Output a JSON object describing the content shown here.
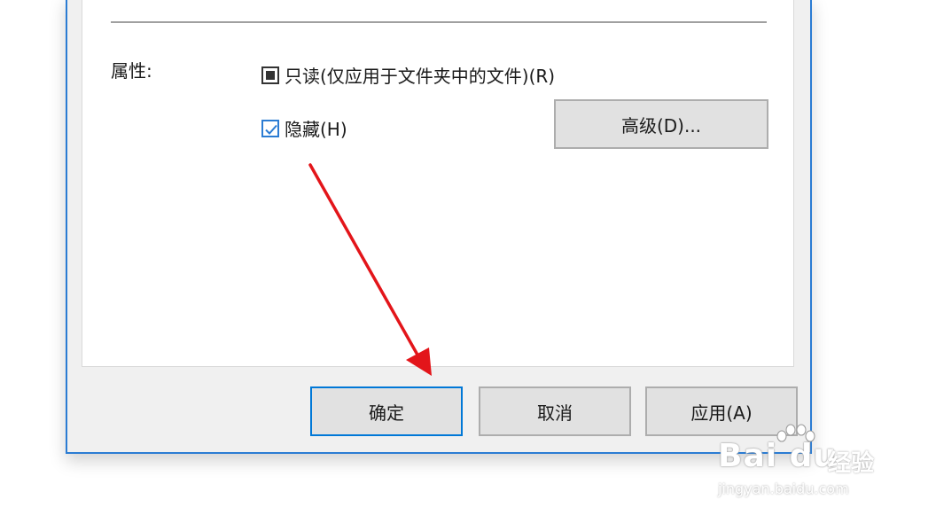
{
  "attributes": {
    "label": "属性:",
    "readonly": {
      "label": "只读(仅应用于文件夹中的文件)(R)",
      "state": "indeterminate"
    },
    "hidden": {
      "label": "隐藏(H)",
      "state": "checked"
    },
    "advanced_button": "高级(D)..."
  },
  "footer": {
    "ok": "确定",
    "cancel": "取消",
    "apply": "应用(A)"
  },
  "colors": {
    "accent": "#0078d7",
    "annotation_arrow": "#e3151a"
  },
  "watermark": {
    "logo": "Bai du",
    "cn": "经验",
    "url": "jingyan.baidu.com"
  }
}
